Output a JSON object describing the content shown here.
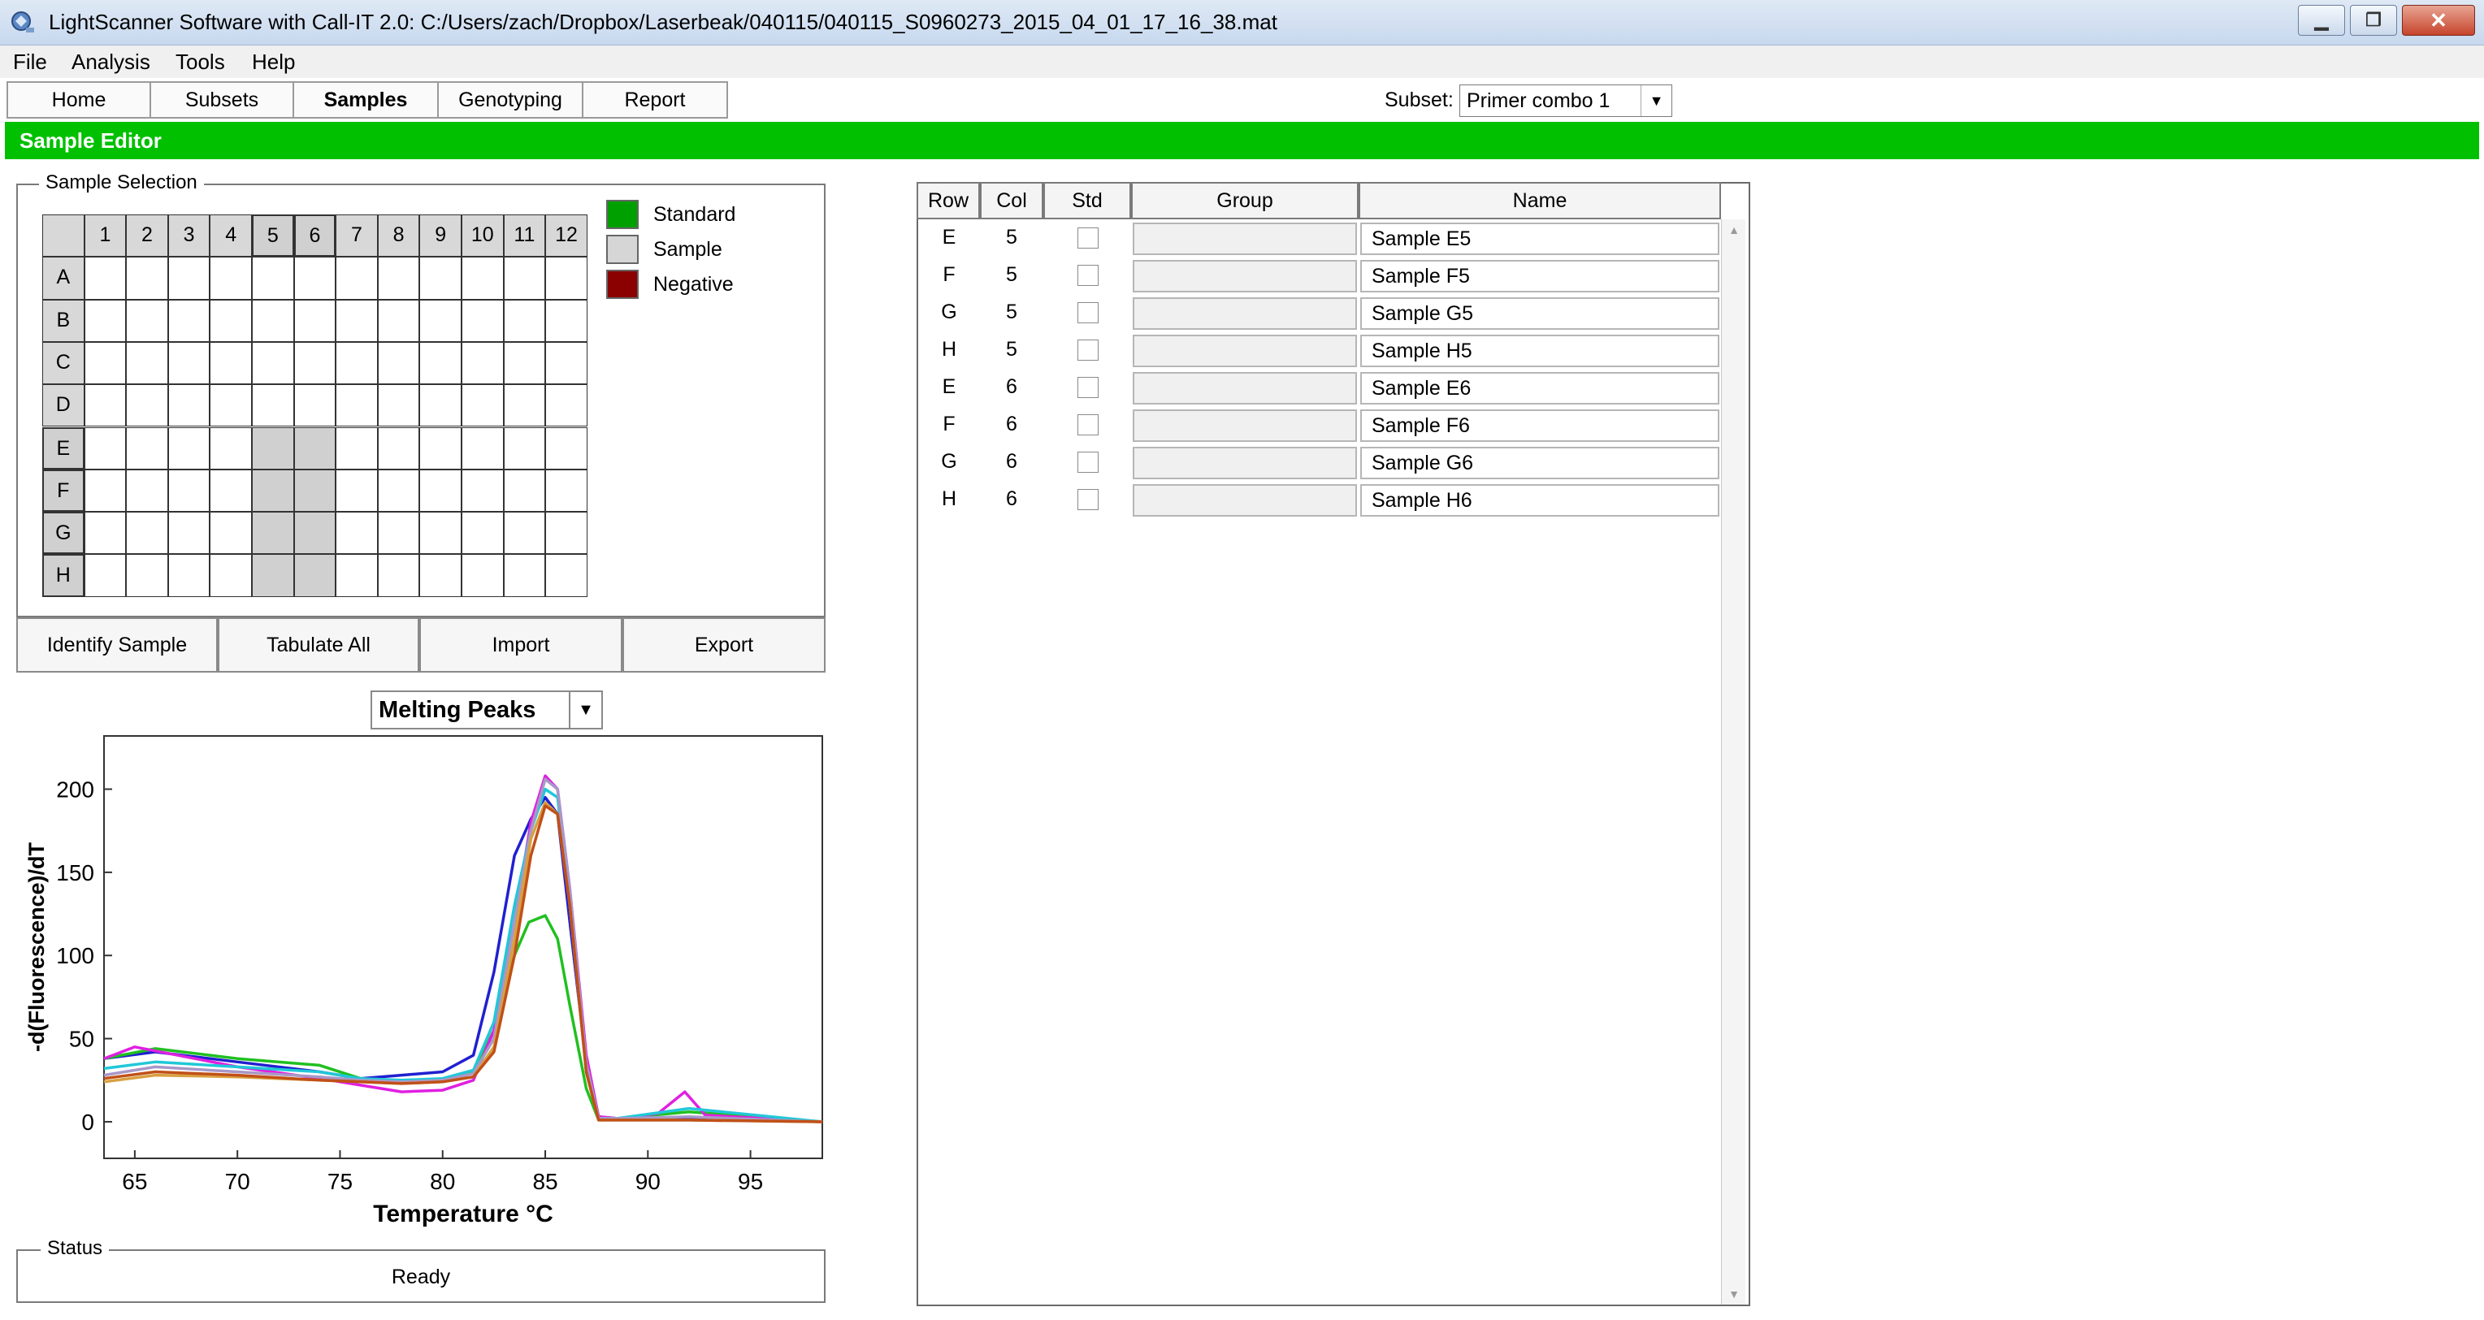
{
  "window": {
    "title": "LightScanner Software with Call-IT 2.0: C:/Users/zach/Dropbox/Laserbeak/040115/040115_S0960273_2015_04_01_17_16_38.mat"
  },
  "menu": [
    "File",
    "Analysis",
    "Tools",
    "Help"
  ],
  "nav": {
    "tabs": [
      "Home",
      "Subsets",
      "Samples",
      "Genotyping",
      "Report"
    ],
    "active": "Samples"
  },
  "subset": {
    "label": "Subset:",
    "value": "Primer combo 1"
  },
  "editor": {
    "title": "Sample Editor"
  },
  "sample_selection": {
    "caption": "Sample Selection",
    "columns": [
      "1",
      "2",
      "3",
      "4",
      "5",
      "6",
      "7",
      "8",
      "9",
      "10",
      "11",
      "12"
    ],
    "rows": [
      "A",
      "B",
      "C",
      "D",
      "E",
      "F",
      "G",
      "H"
    ],
    "selected_columns": [
      "5",
      "6"
    ],
    "selected_rows": [
      "E",
      "F",
      "G",
      "H"
    ],
    "legend": [
      {
        "label": "Standard",
        "color": "#00a000"
      },
      {
        "label": "Sample",
        "color": "#d6d6d6"
      },
      {
        "label": "Negative",
        "color": "#8b0000"
      }
    ]
  },
  "actions": [
    "Identify Sample",
    "Tabulate All",
    "Import",
    "Export"
  ],
  "chart_selector": {
    "value": "Melting Peaks"
  },
  "chart_data": {
    "type": "line",
    "xlabel": "Temperature °C",
    "ylabel": "-d(Fluorescence)/dT",
    "xlim": [
      63.5,
      98.5
    ],
    "ylim": [
      -22,
      232
    ],
    "xticks": [
      65,
      70,
      75,
      80,
      85,
      90,
      95
    ],
    "yticks": [
      0,
      50,
      100,
      150,
      200
    ],
    "grid": false,
    "series": [
      {
        "color": "#2020d0",
        "x": [
          63.5,
          66,
          70,
          74,
          76,
          78,
          80,
          81.5,
          82.5,
          83.5,
          84.3,
          85,
          85.6,
          86.2,
          87,
          87.6,
          88.5,
          92,
          98.5
        ],
        "y": [
          38,
          42,
          36,
          30,
          26,
          28,
          30,
          40,
          90,
          160,
          182,
          195,
          185,
          120,
          35,
          3,
          2,
          2,
          0
        ]
      },
      {
        "color": "#20c020",
        "x": [
          63.5,
          66,
          70,
          74,
          76,
          78,
          80,
          81.5,
          82.5,
          83.5,
          84.2,
          85,
          85.6,
          86.2,
          87,
          87.6,
          88.5,
          92,
          98.5
        ],
        "y": [
          38,
          44,
          38,
          34,
          26,
          24,
          24,
          30,
          55,
          100,
          120,
          124,
          110,
          70,
          20,
          1,
          2,
          6,
          0
        ]
      },
      {
        "color": "#e020e0",
        "x": [
          63.5,
          65,
          70,
          74,
          76,
          78,
          80,
          81.5,
          82.5,
          83.5,
          84.3,
          85,
          85.6,
          86.2,
          87,
          87.6,
          88.5,
          90.5,
          91.8,
          92.8,
          98.5
        ],
        "y": [
          38,
          45,
          33,
          26,
          22,
          18,
          19,
          25,
          55,
          120,
          180,
          208,
          200,
          140,
          40,
          3,
          2,
          5,
          18,
          4,
          0
        ]
      },
      {
        "color": "#20c8d8",
        "x": [
          63.5,
          66,
          70,
          74,
          76,
          78,
          80,
          81.5,
          82.5,
          83.5,
          84.3,
          85,
          85.6,
          86.2,
          87,
          87.6,
          88.5,
          92,
          98.5
        ],
        "y": [
          32,
          36,
          33,
          30,
          26,
          25,
          26,
          31,
          60,
          130,
          175,
          200,
          195,
          130,
          30,
          2,
          2,
          8,
          0
        ]
      },
      {
        "color": "#a898c8",
        "x": [
          63.5,
          66,
          70,
          74,
          76,
          78,
          80,
          81.5,
          82.5,
          83.5,
          84.3,
          85,
          85.6,
          86.2,
          87,
          87.6,
          88.5,
          92,
          98.5
        ],
        "y": [
          28,
          33,
          30,
          27,
          25,
          24,
          25,
          29,
          50,
          120,
          175,
          206,
          200,
          140,
          35,
          2,
          2,
          3,
          0
        ]
      },
      {
        "color": "#d8a040",
        "x": [
          63.5,
          66,
          70,
          74,
          76,
          78,
          80,
          81.5,
          82.5,
          83.5,
          84.3,
          85,
          85.6,
          86.2,
          87,
          87.6,
          88.5,
          92,
          98.5
        ],
        "y": [
          24,
          28,
          27,
          25,
          24,
          23,
          24,
          27,
          45,
          110,
          170,
          192,
          185,
          130,
          30,
          1,
          1,
          1,
          0
        ]
      },
      {
        "color": "#c05018",
        "x": [
          63.5,
          66,
          70,
          74,
          76,
          78,
          80,
          81.5,
          82.5,
          83.5,
          84.3,
          85,
          85.6,
          86.2,
          87,
          87.6,
          88.5,
          92,
          98.5
        ],
        "y": [
          26,
          30,
          28,
          25,
          24,
          23,
          24,
          27,
          42,
          100,
          160,
          190,
          185,
          130,
          30,
          1,
          1,
          1,
          0
        ]
      }
    ]
  },
  "status": {
    "caption": "Status",
    "text": "Ready"
  },
  "table": {
    "headers": [
      "Row",
      "Col",
      "Std",
      "Group",
      "Name"
    ],
    "rows": [
      {
        "row": "E",
        "col": "5",
        "name": "Sample E5"
      },
      {
        "row": "F",
        "col": "5",
        "name": "Sample F5"
      },
      {
        "row": "G",
        "col": "5",
        "name": "Sample G5"
      },
      {
        "row": "H",
        "col": "5",
        "name": "Sample H5"
      },
      {
        "row": "E",
        "col": "6",
        "name": "Sample E6"
      },
      {
        "row": "F",
        "col": "6",
        "name": "Sample F6"
      },
      {
        "row": "G",
        "col": "6",
        "name": "Sample G6"
      },
      {
        "row": "H",
        "col": "6",
        "name": "Sample H6"
      }
    ]
  }
}
